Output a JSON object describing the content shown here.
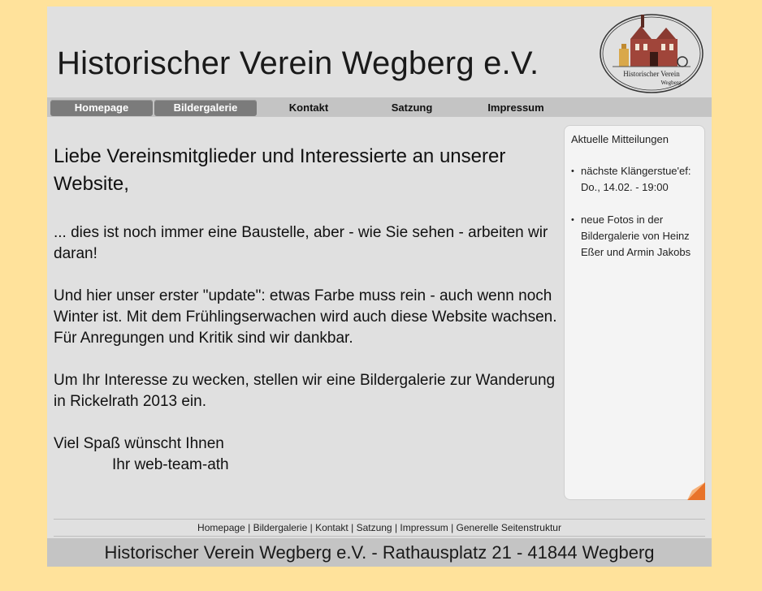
{
  "header": {
    "title": "Historischer Verein Wegberg e.V.",
    "logo_line1": "Historischer Verein",
    "logo_line2": "Wegberg"
  },
  "nav": [
    {
      "label": "Homepage",
      "active": true
    },
    {
      "label": "Bildergalerie",
      "active": true
    },
    {
      "label": "Kontakt",
      "active": false
    },
    {
      "label": "Satzung",
      "active": false
    },
    {
      "label": "Impressum",
      "active": false
    }
  ],
  "main": {
    "heading": "Liebe Vereinsmitglieder und Interessierte an unserer Website,",
    "p1": "... dies ist noch immer eine Baustelle, aber - wie Sie sehen - arbeiten wir daran!",
    "p2": "Und hier unser erster \"update\": etwas Farbe muss rein - auch wenn noch Winter ist. Mit dem Frühlingserwachen wird auch diese Website wachsen. Für Anregungen und Kritik sind wir dankbar.",
    "p3": "Um Ihr Interesse zu wecken, stellen wir eine Bildergalerie zur Wanderung in Rickelrath 2013 ein.",
    "closing": "Viel Spaß wünscht Ihnen",
    "signer": "Ihr web-team-ath"
  },
  "sidebar": {
    "title": "Aktuelle Mitteilungen",
    "items": [
      "nächste Klängerstue'ef: Do., 14.02. - 19:00",
      "neue Fotos in der Bildergalerie von Heinz Eßer und Armin Jakobs"
    ]
  },
  "footer": {
    "links": [
      "Homepage",
      "Bildergalerie",
      "Kontakt",
      "Satzung",
      "Impressum",
      "Generelle Seitenstruktur"
    ],
    "address": "Historischer Verein Wegberg e.V. - Rathausplatz 21 - 41844 Wegberg"
  },
  "colors": {
    "background": "#ffe29b",
    "page": "#e0e0e0",
    "nav_active": "#7b7b7b",
    "accent_corner": "#e8732a"
  }
}
